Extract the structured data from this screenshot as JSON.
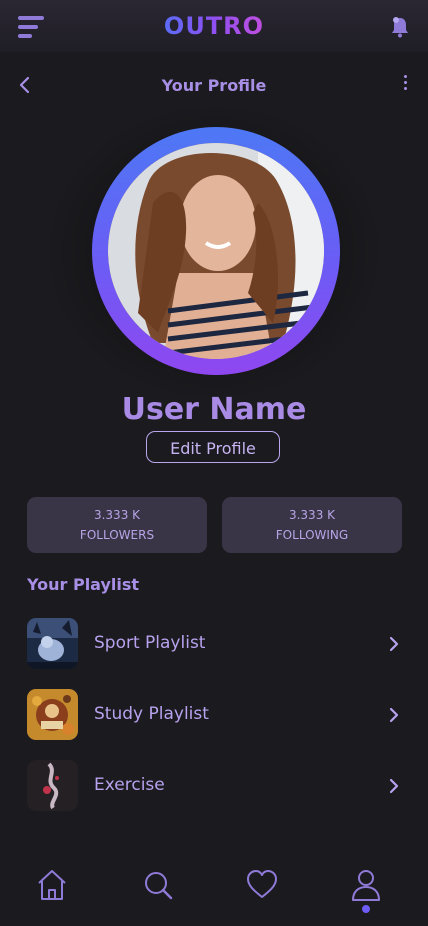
{
  "app": {
    "logo": "OUTRO"
  },
  "header": {
    "title": "Your Profile"
  },
  "profile": {
    "name": "User Name",
    "edit_label": "Edit Profile"
  },
  "stats": [
    {
      "value": "3.333 K",
      "label": "FOLLOWERS"
    },
    {
      "value": "3.333 K",
      "label": "FOLLOWING"
    }
  ],
  "playlist": {
    "title": "Your Playlist",
    "items": [
      {
        "label": "Sport Playlist"
      },
      {
        "label": "Study Playlist"
      },
      {
        "label": "Exercise"
      }
    ]
  },
  "nav": {
    "items": [
      "home-icon",
      "search-icon",
      "heart-icon",
      "profile-icon"
    ],
    "active": "profile-icon"
  },
  "colors": {
    "accent": "#7a5cf5",
    "text_accent": "#a88fe6",
    "card_bg": "#3a3447",
    "background": "#1b1a1e"
  }
}
